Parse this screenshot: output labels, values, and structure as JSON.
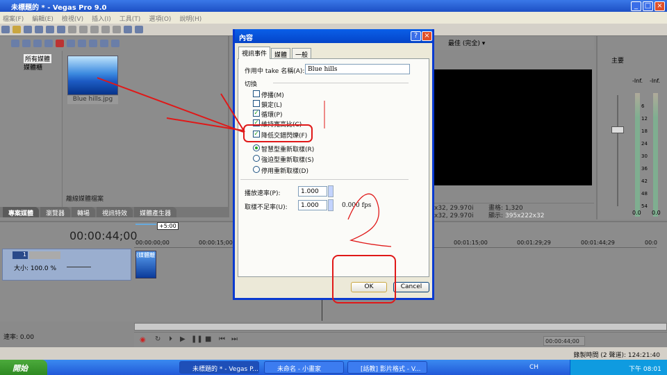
{
  "window": {
    "title": "未標題的 * - Vegas Pro 9.0"
  },
  "menu": [
    "檔案(F)",
    "編輯(E)",
    "檢視(V)",
    "插入(I)",
    "工具(T)",
    "選項(O)",
    "說明(H)"
  ],
  "explorer": {
    "tree": [
      "所有媒體",
      "媒體櫃"
    ],
    "media": [
      {
        "name": "Blue hills.jpg"
      }
    ],
    "offline_label": "離線媒體檔案"
  },
  "tabs": [
    "專案媒體",
    "瀏覽器",
    "轉場",
    "視訊特效",
    "媒體產生器"
  ],
  "preview": {
    "quality": "最佳 (完全)",
    "info_line1": "x32, 29.970i",
    "info_line2": "x32, 29.970i",
    "frame_label": "畫格: 1,320",
    "display_label": "顯示:",
    "display_value": "395x222x32"
  },
  "mixer": {
    "title": "主要",
    "peak_left": "-Inf.",
    "peak_right": "-Inf.",
    "scale": [
      "6",
      "12",
      "18",
      "24",
      "30",
      "36",
      "42",
      "48",
      "54"
    ],
    "level_left": "0.0",
    "level_right": "0.0"
  },
  "timeline": {
    "timecode": "00:00:44;00",
    "zoom_marker": "+5:00",
    "ruler": [
      "00:00:00;00",
      "00:00:15;00",
      "00:01:15;00",
      "00:01:29;29",
      "00:01:44;29",
      "00:0"
    ],
    "track": {
      "number": "1",
      "size_label": "大小: 100.0 %"
    },
    "clip_label": "(媒體離"
  },
  "transport": {
    "rate_label": "速率: 0.00",
    "timecode": "00:00:44;00"
  },
  "status": {
    "record_time": "錄製時間 (2 聲道): 124:21:40"
  },
  "taskbar": {
    "start": "開始",
    "tasks": [
      "未標題的 * - Vegas P...",
      "未命名 - 小畫家",
      "[話教] 影片格式 - V..."
    ],
    "lang": "CH",
    "clock": "下午 08:01"
  },
  "dialog": {
    "title": "內容",
    "tabs": [
      "視訊事件",
      "媒體",
      "一般"
    ],
    "take_label": "作用中 take 名稱(A):",
    "take_value": "Blue hills",
    "switches_label": "切換",
    "checkboxes": [
      {
        "label": "停播(M)",
        "checked": false
      },
      {
        "label": "鎖定(L)",
        "checked": false
      },
      {
        "label": "循環(P)",
        "checked": true
      },
      {
        "label": "維持寬高比(C)",
        "checked": true
      },
      {
        "label": "降低交錯閃爍(F)",
        "checked": true
      }
    ],
    "radios": [
      {
        "label": "智慧型重新取樣(R)",
        "selected": true
      },
      {
        "label": "強迫型重新取樣(S)",
        "selected": false
      },
      {
        "label": "停用重新取樣(D)",
        "selected": false
      }
    ],
    "playback_rate_label": "播放速率(P):",
    "playback_rate_value": "1.000",
    "undersample_label": "取樣不足率(U):",
    "undersample_value": "1.000",
    "fps_text": "0.000 fps",
    "ok": "OK",
    "cancel": "Cancel",
    "help_btn": "?",
    "close_btn": "×"
  },
  "annotation": {
    "text": "2",
    "color": "#e01818"
  }
}
